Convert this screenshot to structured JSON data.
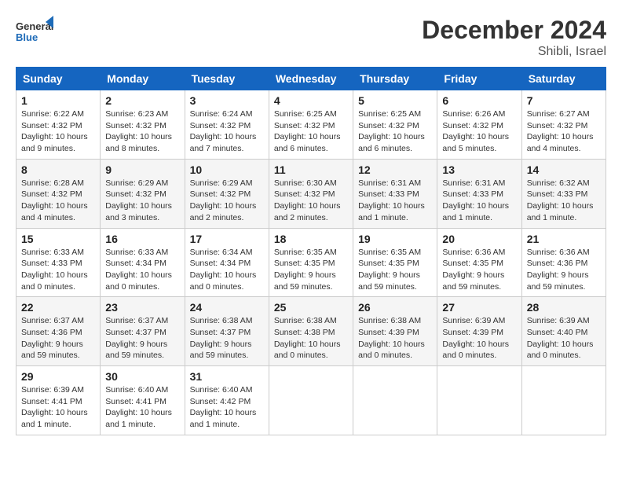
{
  "header": {
    "logo_general": "General",
    "logo_blue": "Blue",
    "month": "December 2024",
    "location": "Shibli, Israel"
  },
  "weekdays": [
    "Sunday",
    "Monday",
    "Tuesday",
    "Wednesday",
    "Thursday",
    "Friday",
    "Saturday"
  ],
  "weeks": [
    [
      {
        "day": "1",
        "sunrise": "6:22 AM",
        "sunset": "4:32 PM",
        "daylight": "10 hours and 9 minutes."
      },
      {
        "day": "2",
        "sunrise": "6:23 AM",
        "sunset": "4:32 PM",
        "daylight": "10 hours and 8 minutes."
      },
      {
        "day": "3",
        "sunrise": "6:24 AM",
        "sunset": "4:32 PM",
        "daylight": "10 hours and 7 minutes."
      },
      {
        "day": "4",
        "sunrise": "6:25 AM",
        "sunset": "4:32 PM",
        "daylight": "10 hours and 6 minutes."
      },
      {
        "day": "5",
        "sunrise": "6:25 AM",
        "sunset": "4:32 PM",
        "daylight": "10 hours and 6 minutes."
      },
      {
        "day": "6",
        "sunrise": "6:26 AM",
        "sunset": "4:32 PM",
        "daylight": "10 hours and 5 minutes."
      },
      {
        "day": "7",
        "sunrise": "6:27 AM",
        "sunset": "4:32 PM",
        "daylight": "10 hours and 4 minutes."
      }
    ],
    [
      {
        "day": "8",
        "sunrise": "6:28 AM",
        "sunset": "4:32 PM",
        "daylight": "10 hours and 4 minutes."
      },
      {
        "day": "9",
        "sunrise": "6:29 AM",
        "sunset": "4:32 PM",
        "daylight": "10 hours and 3 minutes."
      },
      {
        "day": "10",
        "sunrise": "6:29 AM",
        "sunset": "4:32 PM",
        "daylight": "10 hours and 2 minutes."
      },
      {
        "day": "11",
        "sunrise": "6:30 AM",
        "sunset": "4:32 PM",
        "daylight": "10 hours and 2 minutes."
      },
      {
        "day": "12",
        "sunrise": "6:31 AM",
        "sunset": "4:33 PM",
        "daylight": "10 hours and 1 minute."
      },
      {
        "day": "13",
        "sunrise": "6:31 AM",
        "sunset": "4:33 PM",
        "daylight": "10 hours and 1 minute."
      },
      {
        "day": "14",
        "sunrise": "6:32 AM",
        "sunset": "4:33 PM",
        "daylight": "10 hours and 1 minute."
      }
    ],
    [
      {
        "day": "15",
        "sunrise": "6:33 AM",
        "sunset": "4:33 PM",
        "daylight": "10 hours and 0 minutes."
      },
      {
        "day": "16",
        "sunrise": "6:33 AM",
        "sunset": "4:34 PM",
        "daylight": "10 hours and 0 minutes."
      },
      {
        "day": "17",
        "sunrise": "6:34 AM",
        "sunset": "4:34 PM",
        "daylight": "10 hours and 0 minutes."
      },
      {
        "day": "18",
        "sunrise": "6:35 AM",
        "sunset": "4:35 PM",
        "daylight": "9 hours and 59 minutes."
      },
      {
        "day": "19",
        "sunrise": "6:35 AM",
        "sunset": "4:35 PM",
        "daylight": "9 hours and 59 minutes."
      },
      {
        "day": "20",
        "sunrise": "6:36 AM",
        "sunset": "4:35 PM",
        "daylight": "9 hours and 59 minutes."
      },
      {
        "day": "21",
        "sunrise": "6:36 AM",
        "sunset": "4:36 PM",
        "daylight": "9 hours and 59 minutes."
      }
    ],
    [
      {
        "day": "22",
        "sunrise": "6:37 AM",
        "sunset": "4:36 PM",
        "daylight": "9 hours and 59 minutes."
      },
      {
        "day": "23",
        "sunrise": "6:37 AM",
        "sunset": "4:37 PM",
        "daylight": "9 hours and 59 minutes."
      },
      {
        "day": "24",
        "sunrise": "6:38 AM",
        "sunset": "4:37 PM",
        "daylight": "9 hours and 59 minutes."
      },
      {
        "day": "25",
        "sunrise": "6:38 AM",
        "sunset": "4:38 PM",
        "daylight": "10 hours and 0 minutes."
      },
      {
        "day": "26",
        "sunrise": "6:38 AM",
        "sunset": "4:39 PM",
        "daylight": "10 hours and 0 minutes."
      },
      {
        "day": "27",
        "sunrise": "6:39 AM",
        "sunset": "4:39 PM",
        "daylight": "10 hours and 0 minutes."
      },
      {
        "day": "28",
        "sunrise": "6:39 AM",
        "sunset": "4:40 PM",
        "daylight": "10 hours and 0 minutes."
      }
    ],
    [
      {
        "day": "29",
        "sunrise": "6:39 AM",
        "sunset": "4:41 PM",
        "daylight": "10 hours and 1 minute."
      },
      {
        "day": "30",
        "sunrise": "6:40 AM",
        "sunset": "4:41 PM",
        "daylight": "10 hours and 1 minute."
      },
      {
        "day": "31",
        "sunrise": "6:40 AM",
        "sunset": "4:42 PM",
        "daylight": "10 hours and 1 minute."
      },
      null,
      null,
      null,
      null
    ]
  ],
  "labels": {
    "sunrise": "Sunrise:",
    "sunset": "Sunset:",
    "daylight": "Daylight:"
  }
}
